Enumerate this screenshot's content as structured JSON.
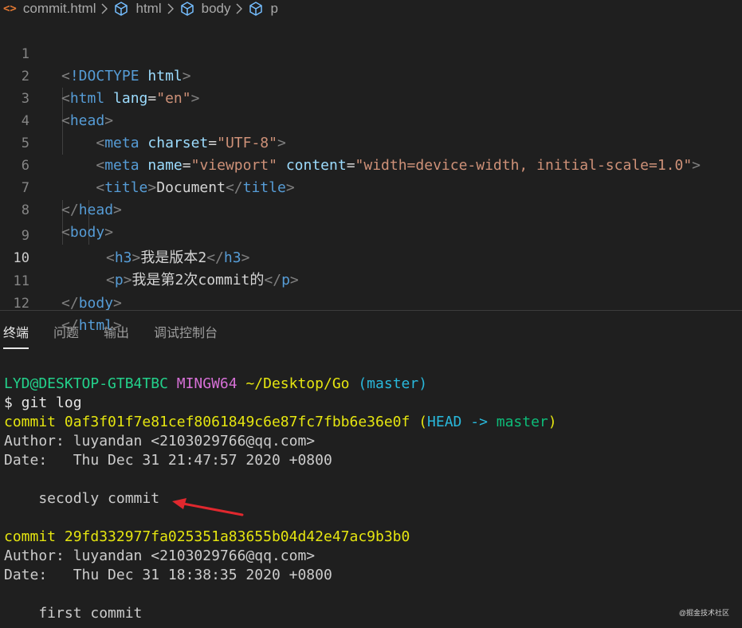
{
  "breadcrumb": {
    "file": "commit.html",
    "items": [
      "html",
      "body",
      "p"
    ],
    "file_icon": "<>"
  },
  "editor": {
    "active_line": 10,
    "lines": [
      {
        "n": "1"
      },
      {
        "n": "2"
      },
      {
        "n": "3"
      },
      {
        "n": "4"
      },
      {
        "n": "5"
      },
      {
        "n": "6"
      },
      {
        "n": "7"
      },
      {
        "n": "8"
      },
      {
        "n": "9"
      },
      {
        "n": "10"
      },
      {
        "n": "11"
      },
      {
        "n": "12"
      }
    ],
    "tokens": {
      "doctype": "!DOCTYPE",
      "html": "html",
      "lang_attr": "lang",
      "lang_val": "\"en\"",
      "head": "head",
      "meta": "meta",
      "charset_attr": "charset",
      "charset_val": "\"UTF-8\"",
      "name_attr": "name",
      "name_val": "\"viewport\"",
      "content_attr": "content",
      "content_val": "\"width=device-width, initial-scale=1.0\"",
      "title": "title",
      "title_text": "Document",
      "body": "body",
      "h3": "h3",
      "h3_text": "我是版本2",
      "p": "p",
      "p_text": "我是第2次commit的"
    }
  },
  "panel": {
    "tabs": [
      "终端",
      "问题",
      "输出",
      "调试控制台"
    ],
    "active_tab": "终端"
  },
  "terminal": {
    "prompt_user": "LYD@DESKTOP-GTB4TBC",
    "prompt_env": "MINGW64",
    "prompt_path": "~/Desktop/Go",
    "prompt_branch": "(master)",
    "command": "$ git log",
    "commits": [
      {
        "label": "commit",
        "hash": "0af3f01f7e81cef8061849c6e87fc7fbb6e36e0f",
        "ref_open": "(",
        "ref_head": "HEAD -> ",
        "ref_branch": "master",
        "ref_close": ")",
        "author": "Author: luyandan <2103029766@qq.com>",
        "date": "Date:   Thu Dec 31 21:47:57 2020 +0800",
        "message": "    secodly commit"
      },
      {
        "label": "commit",
        "hash": "29fd332977fa025351a83655b04d42e47ac9b3b0",
        "author": "Author: luyandan <2103029766@qq.com>",
        "date": "Date:   Thu Dec 31 18:38:35 2020 +0800",
        "message": "    first commit"
      }
    ]
  },
  "watermark": "@掘金技术社区",
  "colors": {
    "background": "#1f1f1f",
    "tag": "#569cd6",
    "attr": "#9cdcfe",
    "string": "#ce9178",
    "annotation_arrow": "#e0282e"
  }
}
